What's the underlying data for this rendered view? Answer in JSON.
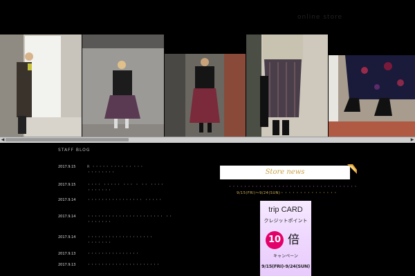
{
  "header": {
    "site_link": "online store"
  },
  "blog": {
    "title": "STAFF BLOG",
    "entries": [
      {
        "date": "2017.9.15",
        "text": "R  ・・・・・ ・・・・ ・・ ・・・\n・・・・・・・・"
      },
      {
        "date": "2017.9.15",
        "text": "・・・・  ・・・・・  ・・・  ・  ・・  ・・・・\n・・・・・・・"
      },
      {
        "date": "2017.9.14",
        "text": "・・・・・・・・・・・・・・・・  ・・・・・"
      },
      {
        "date": "2017.9.14",
        "text": "・・・・・・・・・・・・・・・・・・・・・・  ・・\n・・・・・・・"
      },
      {
        "date": "2017.9.14",
        "text": "・・・・・・・・・・・・・・・・・・・\n・・・・・・・"
      },
      {
        "date": "2017.9.13",
        "text": "・・・・・・・・・・・・・・・"
      },
      {
        "date": "2017.9.13",
        "text": "・・・・・・・・・・・・・・・・・・・・・"
      }
    ]
  },
  "store": {
    "banner": "Store news",
    "line1": "・・・・・・・・・・・・・・・・・・・・・・・・・・・・・・・・・・",
    "line2": "9/15(FRI)〜9/24(SUN)・・・・・・・・・・・・・・・"
  },
  "card": {
    "title": "trip CARD",
    "subtitle": "クレジットポイント",
    "number": "10",
    "multiplier": "倍",
    "campaign": "キャンペーン",
    "dates": "9/15(FRI)-9/24(SUN)"
  },
  "colors": {
    "banner_text": "#c9a24a",
    "news_pink": "#d76bd6",
    "news_gold": "#d9b85a",
    "card_circle": "#e4006a"
  },
  "icons": [
    "corner-ribbon-icon",
    "scroll-left-icon",
    "scroll-right-icon"
  ]
}
